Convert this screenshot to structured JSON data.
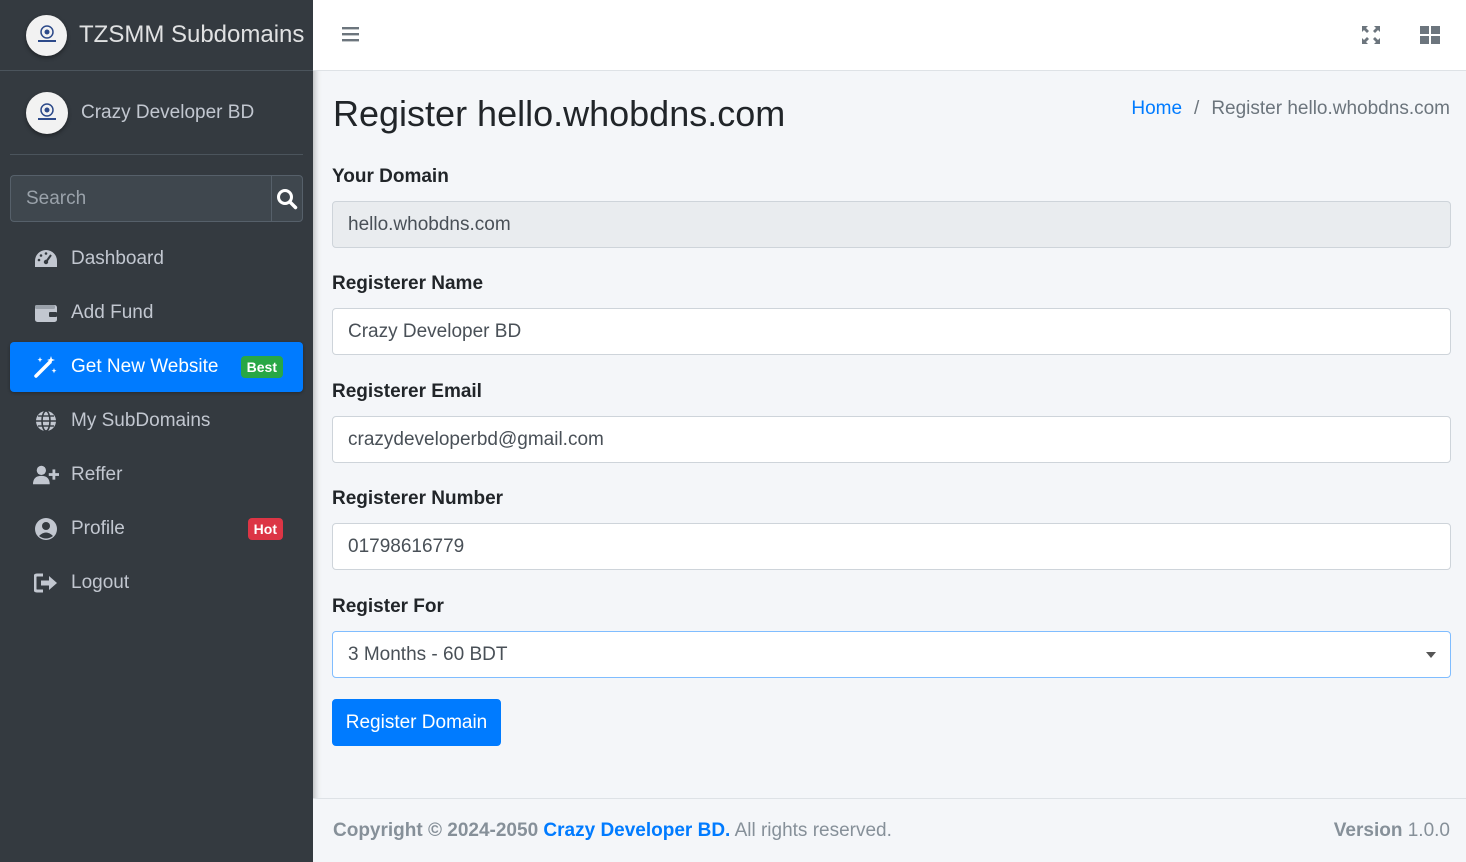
{
  "brand": {
    "title": "TZSMM Subdomains"
  },
  "user": {
    "name": "Crazy Developer BD"
  },
  "search": {
    "placeholder": "Search"
  },
  "sidebar": {
    "items": [
      {
        "label": "Dashboard",
        "icon": "dashboard-icon"
      },
      {
        "label": "Add Fund",
        "icon": "wallet-icon"
      },
      {
        "label": "Get New Website",
        "icon": "magic-wand-icon",
        "badge": "Best",
        "active": true
      },
      {
        "label": "My SubDomains",
        "icon": "globe-icon"
      },
      {
        "label": "Reffer",
        "icon": "user-plus-icon"
      },
      {
        "label": "Profile",
        "icon": "user-circle-icon",
        "badge": "Hot"
      },
      {
        "label": "Logout",
        "icon": "logout-icon"
      }
    ]
  },
  "page": {
    "title": "Register hello.whobdns.com",
    "breadcrumb": {
      "home": "Home",
      "current": "Register hello.whobdns.com"
    }
  },
  "form": {
    "domain": {
      "label": "Your Domain",
      "value": "hello.whobdns.com"
    },
    "name": {
      "label": "Registerer Name",
      "value": "Crazy Developer BD"
    },
    "email": {
      "label": "Registerer Email",
      "value": "crazydeveloperbd@gmail.com"
    },
    "number": {
      "label": "Registerer Number",
      "value": "01798616779"
    },
    "period": {
      "label": "Register For",
      "value": "3 Months - 60 BDT"
    },
    "submit_label": "Register Domain"
  },
  "footer": {
    "copyright_prefix": "Copyright © 2024-2050",
    "company": "Crazy Developer BD.",
    "rights": "All rights reserved.",
    "version_label": "Version",
    "version": "1.0.0"
  },
  "colors": {
    "primary": "#007bff",
    "sidebar": "#343a40",
    "success": "#28a745",
    "danger": "#dc3545"
  }
}
